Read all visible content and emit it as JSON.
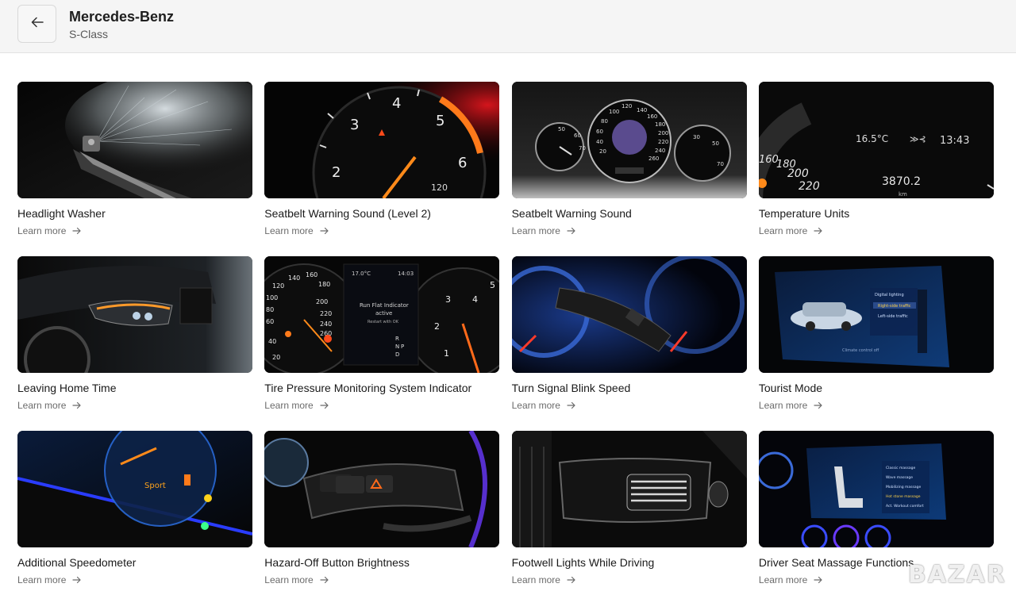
{
  "header": {
    "title": "Mercedes-Benz",
    "subtitle": "S-Class",
    "back_icon": "arrow-left-icon"
  },
  "cards": [
    {
      "title": "Headlight Washer",
      "link": "Learn more",
      "thumb": "headlight-washer-photo"
    },
    {
      "title": "Seatbelt Warning Sound (Level 2)",
      "link": "Learn more",
      "thumb": "tachometer-photo"
    },
    {
      "title": "Seatbelt Warning Sound",
      "link": "Learn more",
      "thumb": "instrument-cluster-photo"
    },
    {
      "title": "Temperature Units",
      "link": "Learn more",
      "thumb": "cluster-display-photo"
    },
    {
      "title": "Leaving Home Time",
      "link": "Learn more",
      "thumb": "headlight-car-photo"
    },
    {
      "title": "Tire Pressure Monitoring System Indicator",
      "link": "Learn more",
      "thumb": "tire-pressure-cluster-photo"
    },
    {
      "title": "Turn Signal Blink Speed",
      "link": "Learn more",
      "thumb": "turn-signal-stalk-photo"
    },
    {
      "title": "Tourist Mode",
      "link": "Learn more",
      "thumb": "infotainment-screen-photo"
    },
    {
      "title": "Additional Speedometer",
      "link": "Learn more",
      "thumb": "digital-speedometer-photo"
    },
    {
      "title": "Hazard-Off Button Brightness",
      "link": "Learn more",
      "thumb": "hazard-button-photo"
    },
    {
      "title": "Footwell Lights While Driving",
      "link": "Learn more",
      "thumb": "air-vent-photo"
    },
    {
      "title": "Driver Seat Massage Functions",
      "link": "Learn more",
      "thumb": "seat-massage-screen-photo"
    }
  ],
  "thumb_text": {
    "c2_nums": [
      "3",
      "4",
      "5",
      "2",
      "6",
      "120"
    ],
    "c3_nums": [
      "140",
      "160",
      "180",
      "200",
      "220",
      "240",
      "260",
      "120",
      "100",
      "80",
      "60",
      "40",
      "20"
    ],
    "c3_small_left": [
      "50",
      "60",
      "70"
    ],
    "c3_small_right": [
      "30",
      "50",
      "70"
    ],
    "c4_temp": "16.5°C",
    "c4_time": "13:43",
    "c4_odo": "3870.2",
    "c4_km": "km",
    "c4_speeds": [
      "160",
      "180",
      "200",
      "220"
    ],
    "c6_temp": "17.0°C",
    "c6_time": "14:03",
    "c6_msg1": "Run Flat Indicator",
    "c6_msg2": "active",
    "c6_msg3": "Restart with OK",
    "c6_left_nums": [
      "140",
      "160",
      "180",
      "200",
      "120",
      "220",
      "240",
      "100",
      "260",
      "80",
      "60",
      "40",
      "20"
    ],
    "c6_right_nums": [
      "3",
      "4",
      "2",
      "1",
      "5"
    ],
    "c6_gears": [
      "R",
      "N",
      "P",
      "D"
    ],
    "c8_menu_title": "Digital lighting",
    "c8_opt1": "Right-side traffic",
    "c8_opt2": "Left-side traffic",
    "c8_footer": "Climate control off",
    "c9_label": "Sport",
    "c12_menu": [
      "Classic massage",
      "Wave massage",
      "Mobilizing massage",
      "Hot stone massage",
      "Act. Workout comfort"
    ]
  },
  "watermark": "BAZAR",
  "colors": {
    "topbar_bg": "#f5f5f5",
    "page_bg": "#ffffff",
    "title_text": "#1a1a1a",
    "link_text": "#6b6b6b",
    "gauge_orange": "#ff7a1a",
    "ambient_blue": "#3a4cff"
  }
}
